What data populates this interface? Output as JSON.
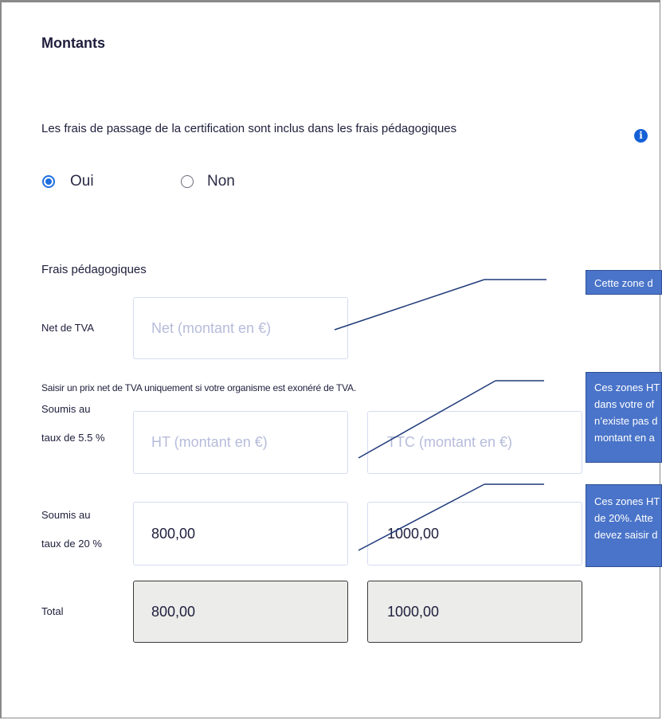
{
  "section": {
    "title": "Montants"
  },
  "certification": {
    "question": "Les frais de passage de la certification sont inclus dans les frais pédagogiques",
    "info_icon": "info-icon",
    "options": [
      {
        "label": "Oui",
        "checked": true
      },
      {
        "label": "Non",
        "checked": false
      }
    ]
  },
  "fees": {
    "title": "Frais pédagogiques",
    "net": {
      "label": "Net de TVA",
      "placeholder": "Net (montant en €)"
    },
    "hint": "Saisir un prix net de TVA uniquement si votre organisme est exonéré de TVA.",
    "rate_55": {
      "label_line1": "Soumis au",
      "label_line2": "taux de 5.5 %",
      "ht_placeholder": "HT (montant en €)",
      "ttc_placeholder": "TTC (montant en €)"
    },
    "rate_20": {
      "label_line1": "Soumis au",
      "label_line2": "taux de 20 %",
      "ht_value": "800,00",
      "ttc_value": "1000,00"
    },
    "total": {
      "label": "Total",
      "ht_value": "800,00",
      "ttc_value": "1000,00"
    }
  },
  "callouts": {
    "net": [
      "Cette zone d"
    ],
    "rate_55": [
      "Ces zones HT",
      "dans votre of",
      "n’existe pas d",
      "montant en a"
    ],
    "rate_20": [
      "Ces zones HT",
      "de 20%. Atte",
      "devez saisir d"
    ]
  },
  "colors": {
    "accent": "#1f6fe0",
    "callout_bg": "#4a74c9",
    "input_border": "#d6dcf0",
    "total_bg": "#ececea"
  }
}
